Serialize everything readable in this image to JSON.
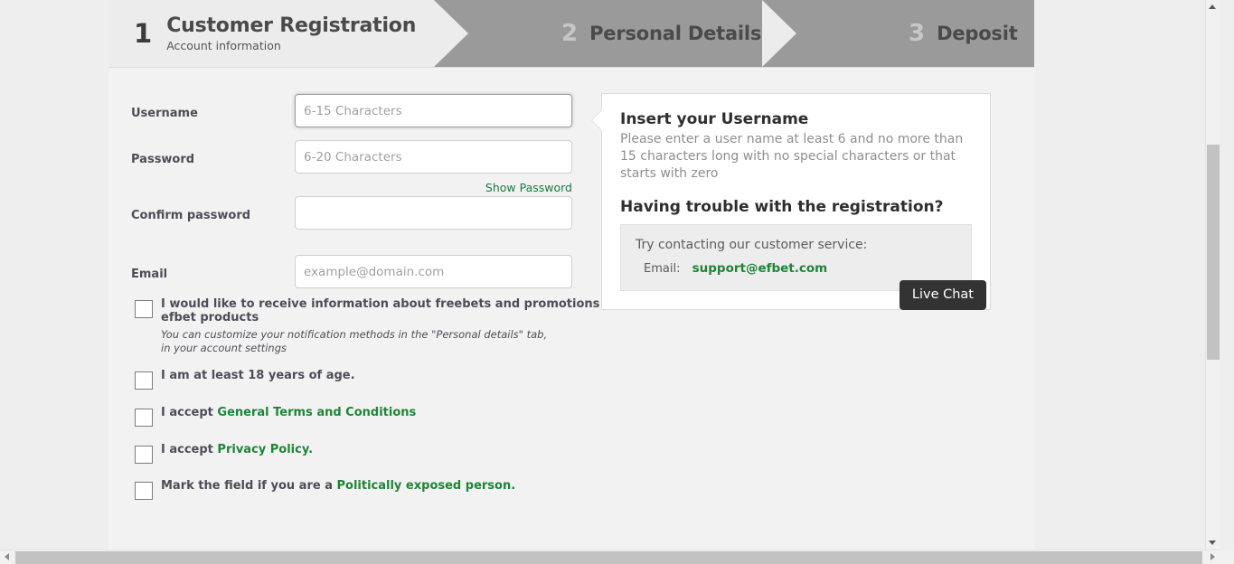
{
  "steps": [
    {
      "number": "1",
      "title": "Customer Registration",
      "subtitle": "Account information"
    },
    {
      "number": "2",
      "title": "Personal Details",
      "subtitle": ""
    },
    {
      "number": "3",
      "title": "Deposit",
      "subtitle": ""
    }
  ],
  "form": {
    "username": {
      "label": "Username",
      "placeholder": "6-15 Characters",
      "value": ""
    },
    "password": {
      "label": "Password",
      "placeholder": "6-20 Characters",
      "value": ""
    },
    "confirm_password": {
      "label": "Confirm password",
      "placeholder": "",
      "value": ""
    },
    "email": {
      "label": "Email",
      "placeholder": "example@domain.com",
      "value": ""
    },
    "show_password_link": "Show Password"
  },
  "checkboxes": [
    {
      "label": "I would like to receive information about freebets and promotions on efbet products",
      "note": "You can customize your notification methods in the \"Personal details\" tab, in your account settings"
    },
    {
      "label": "I am at least 18 years of age."
    },
    {
      "label_prefix": "I accept ",
      "link": "General Terms and Conditions"
    },
    {
      "label_prefix": "I accept ",
      "link": "Privacy Policy."
    },
    {
      "label_prefix": "Mark the field if you are a ",
      "link": "Politically exposed person."
    }
  ],
  "info_panel": {
    "title": "Insert your Username",
    "text": "Please enter a user name at least 6 and no more than 15 characters long with no special characters or that starts with zero",
    "trouble_title": "Having trouble with the registration?",
    "support_line": "Try contacting our customer service:",
    "email_label": "Email:",
    "email_value": "support@efbet.com",
    "live_chat_label": "Live Chat"
  },
  "colors": {
    "accent_green": "#1f8438",
    "step_active_bg": "#ececec",
    "step_inactive_bg": "#9a9a9a",
    "live_chat_bg": "#333333"
  }
}
